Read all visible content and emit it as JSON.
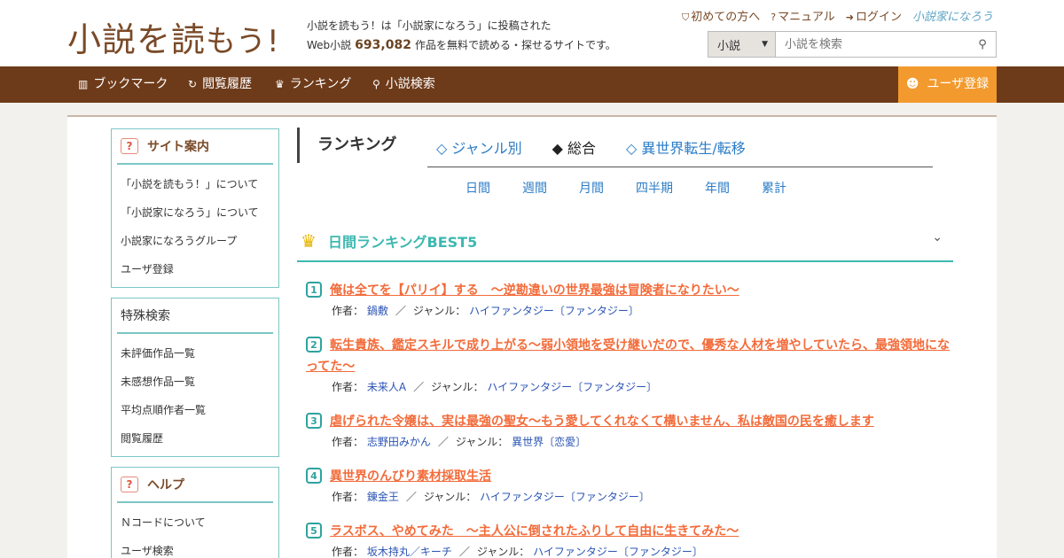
{
  "header": {
    "logo_main": "小説を読",
    "logo_tail": "もう!",
    "tagline_line1": "小説を読もう！は「小説家になろう」に投稿された",
    "tagline_prefix": "Web小説",
    "work_count": "693,082",
    "tagline_suffix": "作品を無料で読める・探せるサイトです。",
    "links": [
      {
        "label": "初めての方へ",
        "icon": "shield-icon"
      },
      {
        "label": "マニュアル",
        "icon": "help-circle-icon"
      },
      {
        "label": "ログイン",
        "icon": "login-icon"
      }
    ],
    "partner_logo": "小説家になろう",
    "search": {
      "category": "小説",
      "placeholder": "小説を検索"
    }
  },
  "nav": {
    "items": [
      {
        "label": "ブックマーク",
        "icon": "bookmark-icon"
      },
      {
        "label": "閲覧履歴",
        "icon": "history-icon"
      },
      {
        "label": "ランキング",
        "icon": "crown-icon"
      },
      {
        "label": "小説検索",
        "icon": "search-icon"
      }
    ],
    "register": "ユーザ登録"
  },
  "sidebar": {
    "site_guide": {
      "title": "サイト案内",
      "items": [
        "「小説を読もう！」について",
        "「小説家になろう」について",
        "小説家になろうグループ",
        "ユーザ登録"
      ]
    },
    "special_search": {
      "title": "特殊検索",
      "items": [
        "未評価作品一覧",
        "未感想作品一覧",
        "平均点順作者一覧",
        "閲覧履歴"
      ]
    },
    "help": {
      "title": "ヘルプ",
      "items": [
        "Ｎコードについて",
        "ユーザ検索"
      ]
    }
  },
  "ranking": {
    "title": "ランキング",
    "tabs": [
      "◇ ジャンル別",
      "◆ 総合",
      "◇ 異世界転生/転移"
    ],
    "active_tab": "◆ 総合",
    "periods": [
      "日間",
      "週間",
      "月間",
      "四半期",
      "年間",
      "累計"
    ],
    "best_title": "日間ランキングBEST5",
    "author_label": "作者：",
    "genre_label": "ジャンル：",
    "entries": [
      {
        "rank": "1",
        "title": "俺は全てを【パリイ】する　〜逆勘違いの世界最強は冒険者になりたい〜",
        "author": "鍋敷",
        "genre": "ハイファンタジー〔ファンタジー〕"
      },
      {
        "rank": "2",
        "title": "転生貴族、鑑定スキルで成り上がる～弱小領地を受け継いだので、優秀な人材を増やしていたら、最強領地になってた～",
        "author": "未来人A",
        "genre": "ハイファンタジー〔ファンタジー〕"
      },
      {
        "rank": "3",
        "title": "虐げられた令嬢は、実は最強の聖女～もう愛してくれなくて構いません、私は敵国の民を癒します",
        "author": "志野田みかん",
        "genre": "異世界〔恋愛〕"
      },
      {
        "rank": "4",
        "title": "異世界のんびり素材採取生活",
        "author": "錬金王",
        "genre": "ハイファンタジー〔ファンタジー〕"
      },
      {
        "rank": "5",
        "title": "ラスボス、やめてみた　～主人公に倒されたふりして自由に生きてみた～",
        "author": "坂木持丸／キーチ",
        "genre": "ハイファンタジー〔ファンタジー〕"
      }
    ]
  },
  "colors": {
    "brand_brown": "#6e3b1a",
    "accent_orange": "#f39a2e",
    "teal": "#3cb8b0",
    "title_orange": "#f36b3a",
    "link_blue": "#2b54b4"
  }
}
